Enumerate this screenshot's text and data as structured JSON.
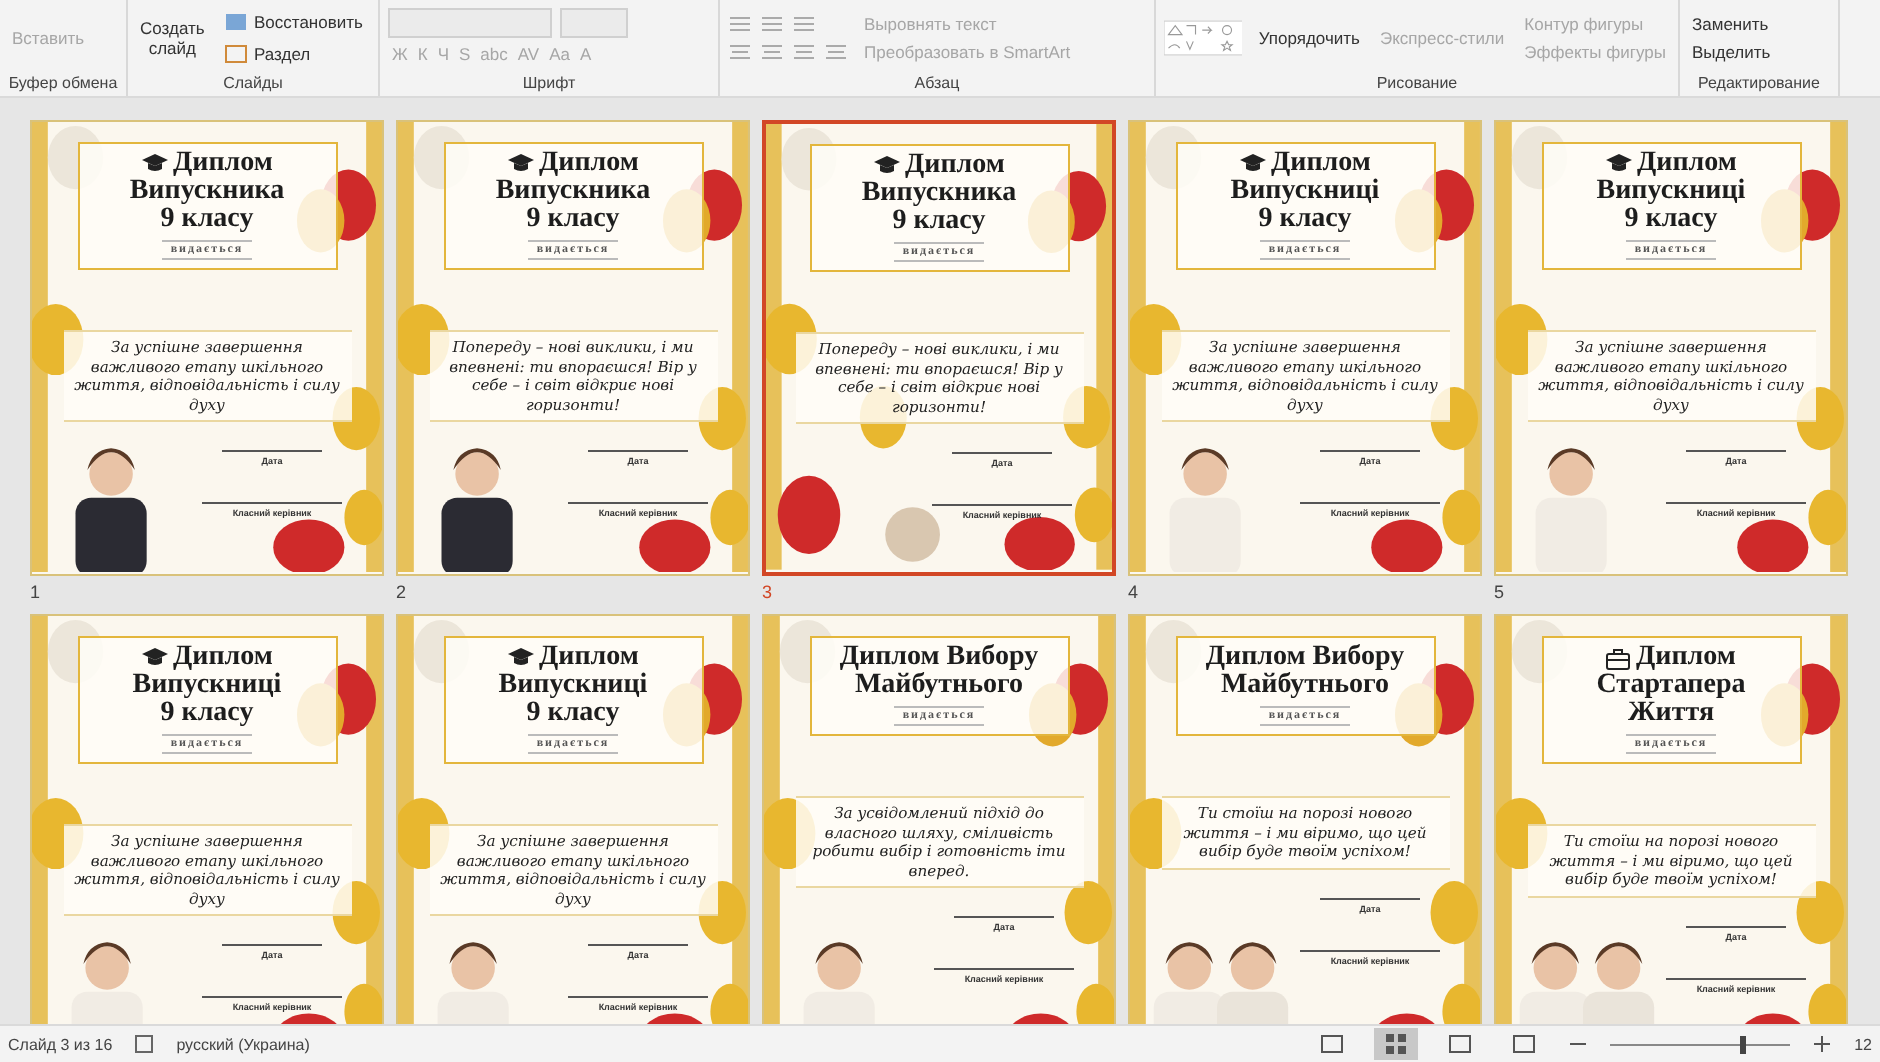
{
  "ribbon": {
    "groups": [
      {
        "label": "Буфер обмена",
        "kind": "clipboard",
        "items": [
          {
            "label": "Вставить",
            "disabled": true
          }
        ]
      },
      {
        "label": "Слайды",
        "kind": "slides",
        "items": [
          {
            "label": "Создать слайд",
            "disabled": false
          },
          {
            "label": "Восстановить",
            "disabled": false
          },
          {
            "label": "Раздел",
            "disabled": false
          }
        ]
      },
      {
        "label": "Шрифт",
        "kind": "font",
        "items": [
          {
            "label": "Ж",
            "disabled": true
          },
          {
            "label": "К",
            "disabled": true
          },
          {
            "label": "Ч",
            "disabled": true
          },
          {
            "label": "S",
            "disabled": true
          },
          {
            "label": "abc",
            "disabled": true
          },
          {
            "label": "AV",
            "disabled": true
          },
          {
            "label": "Aa",
            "disabled": true
          },
          {
            "label": "A",
            "disabled": true
          }
        ]
      },
      {
        "label": "Абзац",
        "kind": "paragraph",
        "items": [
          {
            "label": "Выровнять текст",
            "disabled": true
          },
          {
            "label": "Преобразовать в SmartArt",
            "disabled": true
          }
        ]
      },
      {
        "label": "Рисование",
        "kind": "drawing",
        "items": [
          {
            "label": "Упорядочить",
            "disabled": false
          },
          {
            "label": "Экспресс-стили",
            "disabled": true
          },
          {
            "label": "Контур фигуры",
            "disabled": true
          },
          {
            "label": "Эффекты фигуры",
            "disabled": true
          }
        ]
      },
      {
        "label": "Редактирование",
        "kind": "editing",
        "items": [
          {
            "label": "Заменить",
            "disabled": false
          },
          {
            "label": "Выделить",
            "disabled": false
          }
        ]
      }
    ]
  },
  "slides": [
    {
      "number": "1",
      "selected": false,
      "kind": "cap",
      "title": [
        "Диплом",
        "Випускника",
        "9 класу"
      ],
      "issued": "видається",
      "body": "За успішне завершення важливого етапу шкільного життя, відповідальність і силу духу",
      "date": "Дата",
      "teacher": "Класний керівник"
    },
    {
      "number": "2",
      "selected": false,
      "kind": "cap",
      "title": [
        "Диплом",
        "Випускника",
        "9 класу"
      ],
      "issued": "видається",
      "body": "Попереду – нові виклики, і ми впевнені: ти впораєшся! Вір у себе – і світ відкриє нові горизонти!",
      "date": "Дата",
      "teacher": "Класний керівник"
    },
    {
      "number": "3",
      "selected": true,
      "kind": "cap",
      "title": [
        "Диплом",
        "Випускника",
        "9 класу"
      ],
      "issued": "видається",
      "body": "Попереду – нові виклики, і ми впевнені: ти впораєшся! Вір у себе – і світ відкриє нові горизонти!",
      "date": "Дата",
      "teacher": "Класний керівник"
    },
    {
      "number": "4",
      "selected": false,
      "kind": "cap",
      "title": [
        "Диплом",
        "Випускниці",
        "9 класу"
      ],
      "issued": "видається",
      "body": "За успішне завершення важливого етапу шкільного життя, відповідальність і силу духу",
      "date": "Дата",
      "teacher": "Класний керівник"
    },
    {
      "number": "5",
      "selected": false,
      "kind": "cap",
      "title": [
        "Диплом",
        "Випускниці",
        "9 класу"
      ],
      "issued": "видається",
      "body": "За успішне завершення важливого етапу шкільного життя, відповідальність і силу духу",
      "date": "Дата",
      "teacher": "Класний керівник"
    },
    {
      "selected": false,
      "kind": "cap",
      "title": [
        "Диплом",
        "Випускниці",
        "9 класу"
      ],
      "issued": "видається",
      "body": "За успішне завершення важливого етапу шкільного життя, відповідальність і силу духу",
      "date": "Дата",
      "teacher": "Класний керівник"
    },
    {
      "selected": false,
      "kind": "cap",
      "title": [
        "Диплом",
        "Випускниці",
        "9 класу"
      ],
      "issued": "видається",
      "body": "За успішне завершення важливого етапу шкільного життя, відповідальність і силу духу",
      "date": "Дата",
      "teacher": "Класний керівник"
    },
    {
      "selected": false,
      "kind": "plain",
      "title": [
        "Диплом Вибору",
        "Майбутнього"
      ],
      "issued": "видається",
      "body": "За усвідомлений підхід до власного шляху, сміливість робити вибір і готовність іти вперед.",
      "date": "Дата",
      "teacher": "Класний керівник"
    },
    {
      "selected": false,
      "kind": "plain",
      "title": [
        "Диплом Вибору",
        "Майбутнього"
      ],
      "issued": "видається",
      "body": "Ти стоїш на порозі нового життя – і ми віримо, що цей вибір буде твоїм успіхом!",
      "date": "Дата",
      "teacher": "Класний керівник"
    },
    {
      "selected": false,
      "kind": "briefcase",
      "title": [
        "Диплом",
        "Стартапера",
        "Життя"
      ],
      "issued": "видається",
      "body": "Ти стоїш на порозі нового життя – і ми віримо, що цей вибір буде твоїм успіхом!",
      "date": "Дата",
      "teacher": "Класний керівник"
    }
  ],
  "status_bar": {
    "slide": "Слайд 3 из 16",
    "language": "русский (Украина)",
    "views": [
      {
        "selected": false
      },
      {
        "selected": true
      },
      {
        "selected": false
      },
      {
        "selected": false
      }
    ],
    "zoom_slider": {
      "level": 0.72
    },
    "zoom": "12"
  }
}
